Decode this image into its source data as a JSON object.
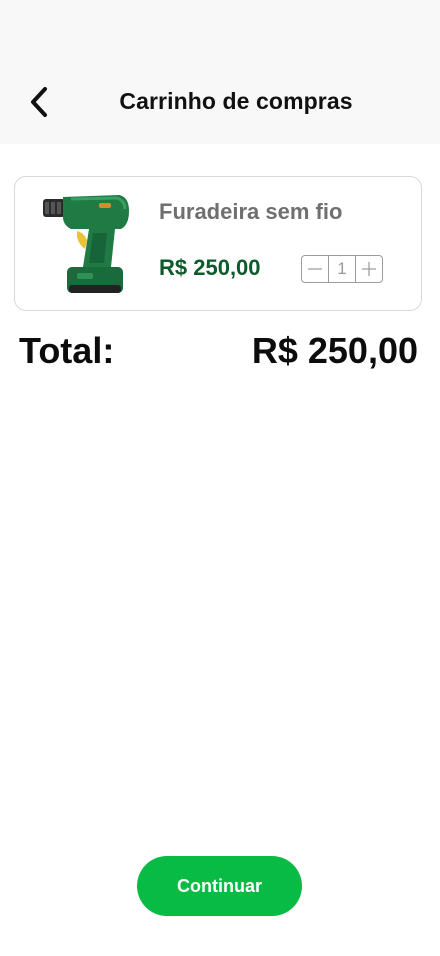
{
  "header": {
    "back_icon": "chevron-left-icon",
    "title": "Carrinho de compras"
  },
  "cart": {
    "items": [
      {
        "name": "Furadeira sem fio",
        "price": "R$ 250,00",
        "quantity": "1",
        "image_icon": "cordless-drill-image"
      }
    ]
  },
  "summary": {
    "total_label": "Total:",
    "total_value": "R$ 250,00"
  },
  "actions": {
    "continue_label": "Continuar"
  },
  "colors": {
    "header_bg": "#f8f8f8",
    "price_green": "#0f5a2c",
    "button_green": "#08bb45",
    "product_name_gray": "#6f6f6f"
  }
}
